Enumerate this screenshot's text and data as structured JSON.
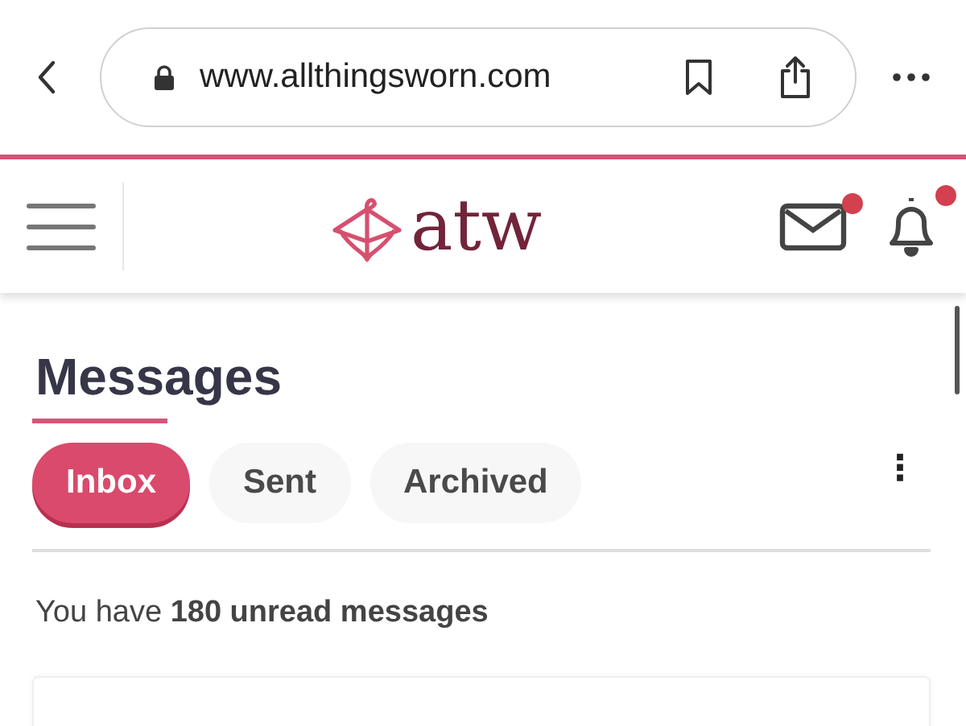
{
  "browser": {
    "url": "www.allthingsworn.com"
  },
  "site_header": {
    "logo": "atw",
    "mail_unread": true,
    "bell_unread": true
  },
  "page": {
    "title": "Messages",
    "tabs": [
      {
        "label": "Inbox",
        "selected": true
      },
      {
        "label": "Sent",
        "selected": false
      },
      {
        "label": "Archived",
        "selected": false
      }
    ],
    "more_button": "⋮",
    "summary": "You have **180 unread messages**"
  }
}
